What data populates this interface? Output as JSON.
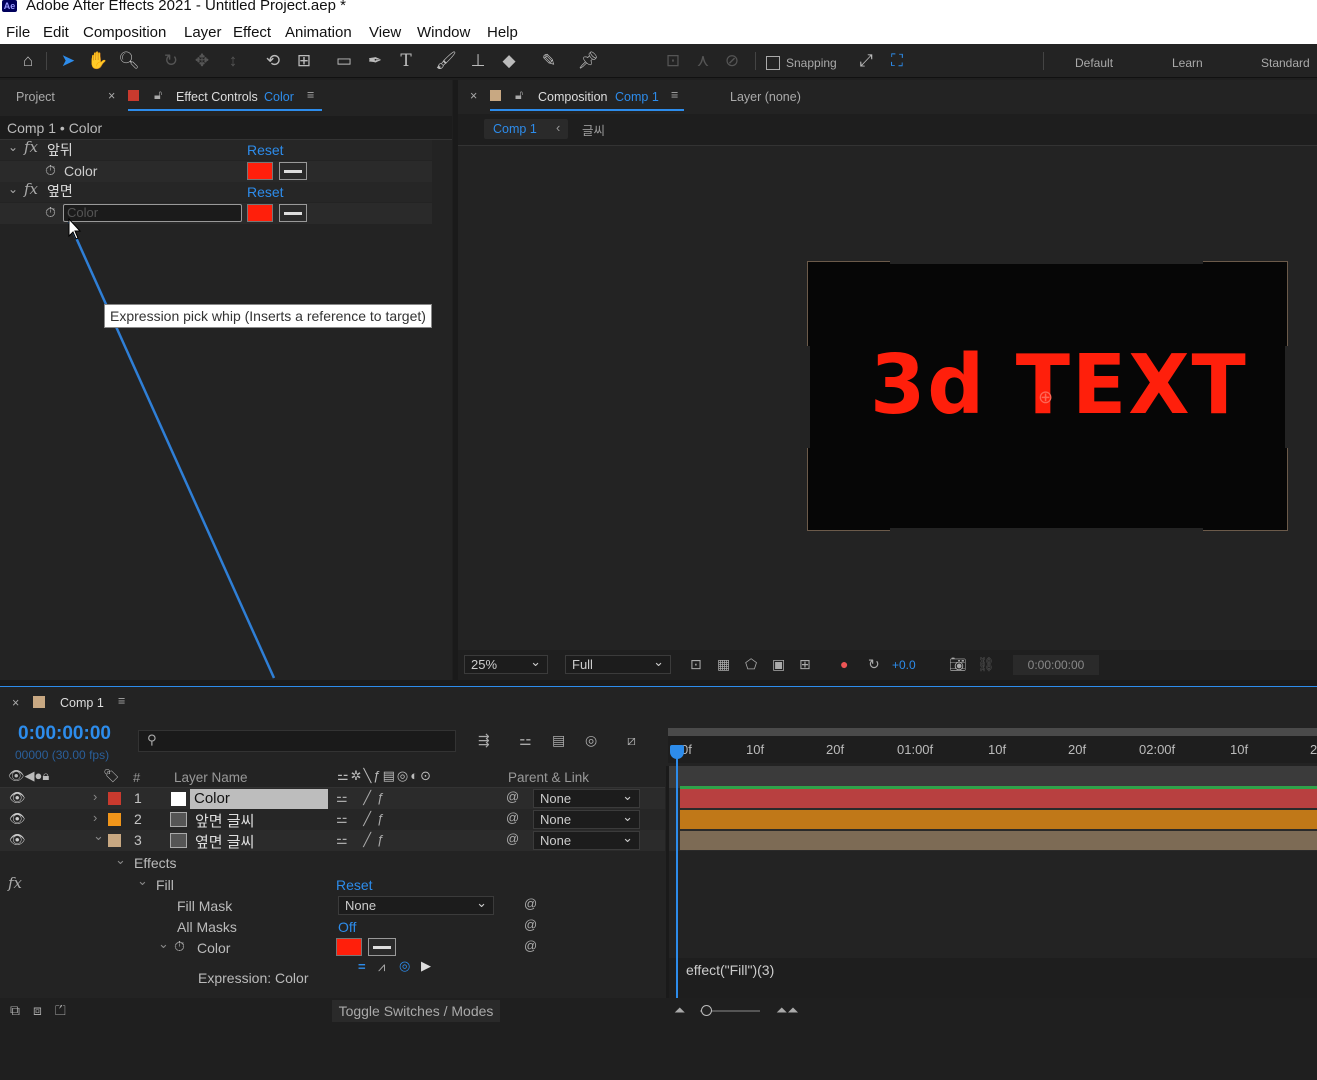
{
  "window": {
    "title": "Adobe After Effects 2021 - Untitled Project.aep *",
    "app_badge": "Ae"
  },
  "menu": [
    "File",
    "Edit",
    "Composition",
    "Layer",
    "Effect",
    "Animation",
    "View",
    "Window",
    "Help"
  ],
  "toolbar": {
    "snapping_label": "Snapping",
    "workspaces": [
      "Default",
      "Learn",
      "Standard"
    ]
  },
  "left_panel": {
    "tab_project": "Project",
    "tab_effect_controls": "Effect Controls",
    "tab_effect_target": "Color",
    "breadcrumb": "Comp 1 • Color",
    "effects": [
      {
        "name": "앞뒤",
        "reset": "Reset",
        "prop": "Color"
      },
      {
        "name": "옆면",
        "reset": "Reset",
        "prop": "Color"
      }
    ]
  },
  "tooltip": "Expression pick whip (Inserts a reference to target)",
  "comp_panel": {
    "tab_label": "Composition",
    "comp_name": "Comp 1",
    "layer_tab": "Layer (none)",
    "flow_item": "Comp 1",
    "flow_item2": "글씨",
    "preview_text": "3d TEXT",
    "zoom": "25%",
    "resolution": "Full",
    "exposure": "+0.0",
    "timecode": "0:00:00:00"
  },
  "timeline": {
    "tab": "Comp 1",
    "timecode": "0:00:00:00",
    "frames": "00000 (30.00 fps)",
    "headers": {
      "num": "#",
      "layer_name": "Layer Name",
      "parent": "Parent & Link"
    },
    "ruler": [
      "0f",
      "10f",
      "20f",
      "01:00f",
      "10f",
      "20f",
      "02:00f",
      "10f",
      "2"
    ],
    "layers": [
      {
        "num": "1",
        "name": "Color",
        "parent": "None",
        "color": "#c93a2e",
        "bar": "#b84040"
      },
      {
        "num": "2",
        "name": "앞면 글씨",
        "parent": "None",
        "color": "#f0951a",
        "bar": "#c07818"
      },
      {
        "num": "3",
        "name": "옆면 글씨",
        "parent": "None",
        "color": "#c8a882",
        "bar": "#7d6b55"
      }
    ],
    "effects_label": "Effects",
    "fill_label": "Fill",
    "fill_reset": "Reset",
    "fill_mask_label": "Fill Mask",
    "fill_mask_value": "None",
    "all_masks_label": "All Masks",
    "all_masks_value": "Off",
    "color_label": "Color",
    "expression_label": "Expression: Color",
    "expression_text": "effect(\"Fill\")(3)",
    "toggle_label": "Toggle Switches / Modes"
  }
}
